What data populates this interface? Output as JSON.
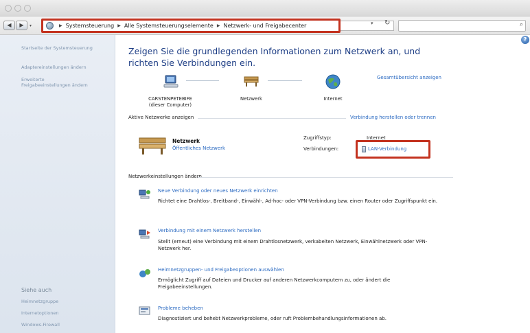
{
  "window": {
    "title": ""
  },
  "address_bar": {
    "crumbs": [
      "Systemsteuerung",
      "Alle Systemsteuerungselemente",
      "Netzwerk- und Freigabecenter"
    ],
    "search_placeholder": ""
  },
  "sidebar": {
    "links": [
      "Startseite der Systemsteuerung",
      "Adaptereinstellungen ändern",
      "Erweiterte",
      "Freigabeeinstellungen ändern"
    ],
    "see_also_heading": "Siehe auch",
    "see_also": [
      "Heimnetzgruppe",
      "Internetoptionen",
      "Windows-Firewall"
    ]
  },
  "main": {
    "headline": "Zeigen Sie die grundlegenden Informationen zum Netzwerk an, und richten Sie Verbindungen ein.",
    "full_map_link": "Gesamtübersicht anzeigen",
    "map": {
      "computer_name": "CARSTENPETEBIFE",
      "computer_note": "(dieser Computer)",
      "network_label": "Netzwerk",
      "internet_label": "Internet"
    },
    "active_networks_label": "Aktive Netzwerke anzeigen",
    "connect_link": "Verbindung herstellen oder trennen",
    "network": {
      "name": "Netzwerk",
      "type": "Öffentliches Netzwerk",
      "access_type_label": "Zugriffstyp:",
      "access_type_value": "Internet",
      "connections_label": "Verbindungen:",
      "connection_value": "LAN-Verbindung"
    },
    "settings_heading": "Netzwerkeinstellungen ändern",
    "tasks": [
      {
        "title": "Neue Verbindung oder neues Netzwerk einrichten",
        "desc": "Richtet eine Drahtlos-, Breitband-, Einwähl-, Ad-hoc- oder VPN-Verbindung bzw. einen Router oder Zugriffspunkt ein."
      },
      {
        "title": "Verbindung mit einem Netzwerk herstellen",
        "desc": "Stellt (erneut) eine Verbindung mit einem Drahtlosnetzwerk, verkabelten Netzwerk, Einwählnetzwerk oder VPN-Netzwerk her."
      },
      {
        "title": "Heimnetzgruppen- und Freigabeoptionen auswählen",
        "desc": "Ermöglicht Zugriff auf Dateien und Drucker auf anderen Netzwerkcomputern zu, oder ändert die Freigabeeinstellungen."
      },
      {
        "title": "Probleme beheben",
        "desc": "Diagnostiziert und behebt Netzwerkprobleme, oder ruft Problembehandlungsinformationen ab."
      }
    ]
  },
  "colors": {
    "highlight_red": "#c3321f",
    "link_blue": "#2c6bc2",
    "headline_blue": "#1f3f86"
  }
}
